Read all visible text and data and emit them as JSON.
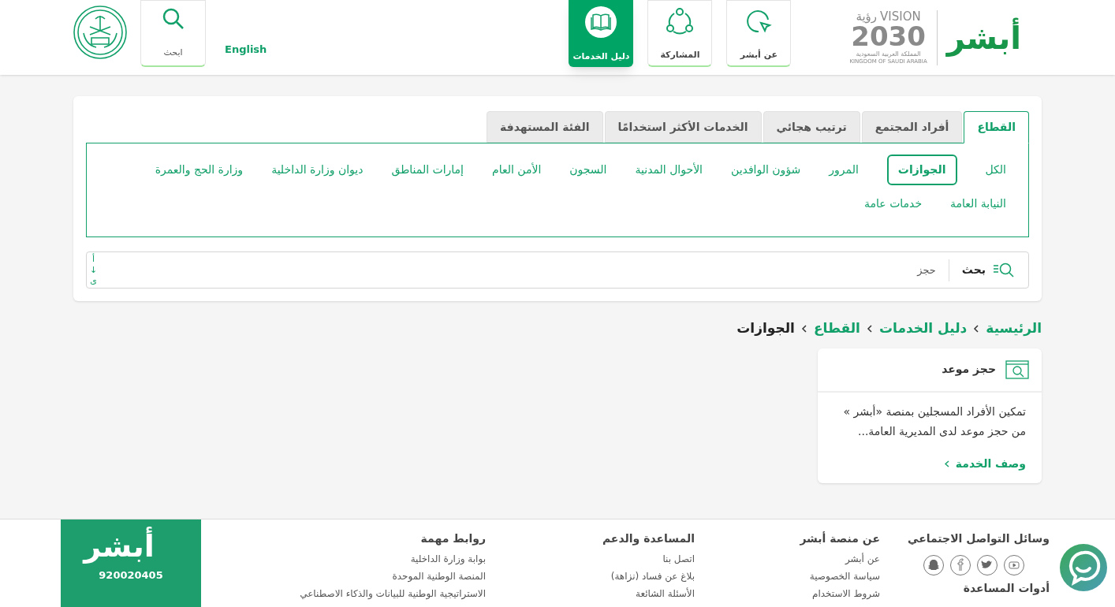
{
  "header": {
    "logo": "أبشر",
    "vision": {
      "word_en": "VISION",
      "word_ar": "رؤية",
      "year": "2030",
      "country_ar": "المملكة العربية السعودية",
      "country_en": "KINGDOM OF SAUDI ARABIA"
    },
    "nav": [
      {
        "label": "عن أبشر",
        "selected": false
      },
      {
        "label": "المشاركة",
        "selected": false
      },
      {
        "label": "دليل الخدمات",
        "selected": true
      }
    ],
    "language_link": "English",
    "search_button": "ابحث"
  },
  "filter_tabs": [
    {
      "label": "القطاع",
      "selected": true
    },
    {
      "label": "أفراد المجتمع",
      "selected": false
    },
    {
      "label": "ترتيب هجائي",
      "selected": false
    },
    {
      "label": "الخدمات الأكثر استخدامًا",
      "selected": false
    },
    {
      "label": "الفئة المستهدفة",
      "selected": false
    }
  ],
  "sectors": [
    {
      "label": "الكل",
      "selected": false
    },
    {
      "label": "الجوازات",
      "selected": true
    },
    {
      "label": "المرور",
      "selected": false
    },
    {
      "label": "شؤون الوافدين",
      "selected": false
    },
    {
      "label": "الأحوال المدنية",
      "selected": false
    },
    {
      "label": "السجون",
      "selected": false
    },
    {
      "label": "الأمن العام",
      "selected": false
    },
    {
      "label": "إمارات المناطق",
      "selected": false
    },
    {
      "label": "ديوان وزارة الداخلية",
      "selected": false
    },
    {
      "label": "وزارة الحج والعمرة",
      "selected": false
    },
    {
      "label": "النيابة العامة",
      "selected": false
    },
    {
      "label": "خدمات عامة",
      "selected": false
    }
  ],
  "search": {
    "label": "بحث",
    "value": "حجز",
    "sort_toggle": [
      "أ",
      "↓",
      "ى"
    ]
  },
  "breadcrumb": [
    "الرئيسية",
    "دليل الخدمات",
    "القطاع",
    "الجوازات"
  ],
  "service_cards": [
    {
      "title": "حجز موعد",
      "description": "تمكين الأفراد المسجلين بمنصة «أبشر » من حجز موعد لدى المديرية العامة...",
      "link": "وصف الخدمة"
    }
  ],
  "footer": {
    "social": {
      "title": "وسائل التواصل الاجتماعي",
      "tools_title": "أدوات المساعدة"
    },
    "columns": [
      {
        "title": "عن منصة أبشر",
        "links": [
          "عن أبشر",
          "سياسة الخصوصية",
          "شروط الاستخدام"
        ]
      },
      {
        "title": "المساعدة والدعم",
        "links": [
          "اتصل بنا",
          "بلاغ عن فساد (نزاهة)",
          "الأسئلة الشائعة"
        ]
      },
      {
        "title": "روابط مهمة",
        "links": [
          "بوابة وزارة الداخلية",
          "المنصة الوطنية الموحدة",
          "الاستراتيجية الوطنية للبيانات والذكاء الاصطناعي"
        ]
      }
    ],
    "brand_box": {
      "logo": "أبشر",
      "phone": "920020405"
    }
  }
}
